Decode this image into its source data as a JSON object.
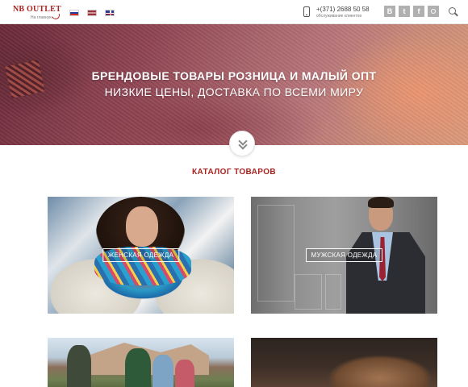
{
  "header": {
    "logo_text": "NB OUTLET",
    "logo_tagline": "На главную",
    "languages": [
      "ru",
      "lv",
      "en"
    ],
    "phone": "+(371) 2688 50 58",
    "phone_caption": "обслуживание клиентов",
    "socials": [
      {
        "name": "vkontakte",
        "glyph": "B"
      },
      {
        "name": "twitter",
        "glyph": "t"
      },
      {
        "name": "facebook",
        "glyph": "f"
      },
      {
        "name": "instagram",
        "glyph": ""
      }
    ]
  },
  "hero": {
    "title": "БРЕНДОВЫЕ ТОВАРЫ РОЗНИЦА И МАЛЫЙ ОПТ",
    "subtitle": "НИЗКИЕ ЦЕНЫ, ДОСТАВКА ПО ВСЕМИ МИРУ"
  },
  "catalog": {
    "title": "КАТАЛОГ ТОВАРОВ",
    "categories": [
      {
        "label": "ЖЕНСКАЯ ОДЕЖДА"
      },
      {
        "label": "МУЖСКАЯ ОДЕЖДА"
      }
    ]
  },
  "colors": {
    "accent": "#a8231f",
    "text": "#444444",
    "social_bg": "#b0b0b0"
  }
}
